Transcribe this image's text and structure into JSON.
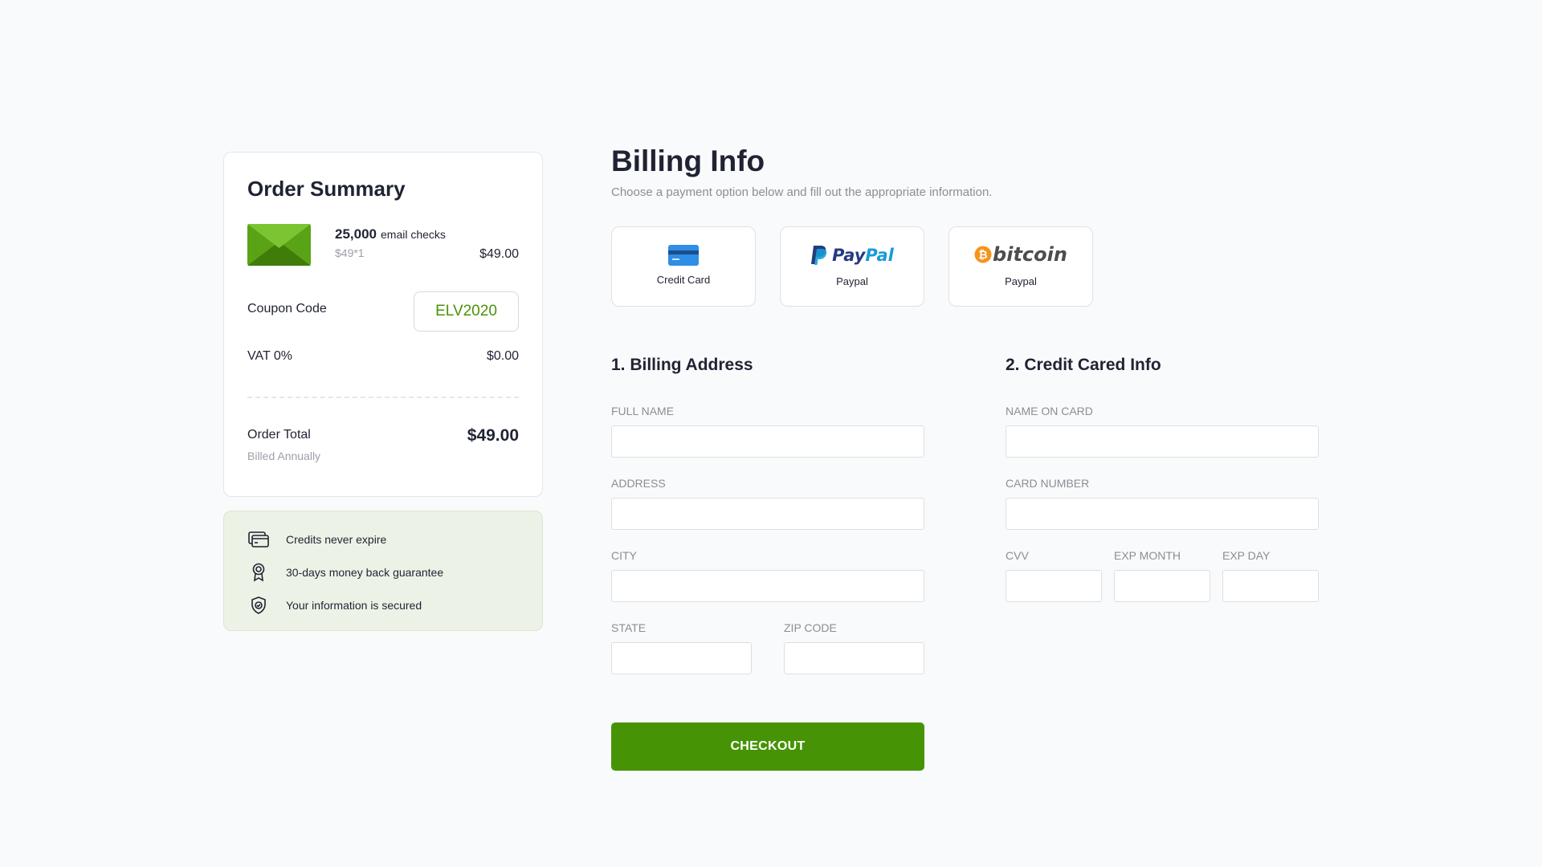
{
  "order_summary": {
    "title": "Order Summary",
    "product": {
      "icon": "envelope-icon",
      "quantity": "25,000",
      "unit_label": "email checks",
      "unit_price": "$49*1",
      "price": "$49.00"
    },
    "coupon": {
      "label": "Coupon Code",
      "value": "ELV2020"
    },
    "vat": {
      "label": "VAT 0%",
      "value": "$0.00"
    },
    "total": {
      "label": "Order Total",
      "sub_label": "Billed Annually",
      "value": "$49.00"
    }
  },
  "benefits": [
    {
      "icon": "credit-card-icon",
      "text": "Credits never expire"
    },
    {
      "icon": "award-ribbon-icon",
      "text": "30-days money back guarantee"
    },
    {
      "icon": "shield-check-icon",
      "text": "Your information is secured"
    }
  ],
  "billing": {
    "title": "Billing Info",
    "subtitle": "Choose a payment option below and fill out the appropriate information.",
    "payment_methods": [
      {
        "icon": "credit-card-icon",
        "label": "Credit Card"
      },
      {
        "icon": "paypal-logo",
        "logo_text_a": "Pay",
        "logo_text_b": "Pal",
        "label": "Paypal"
      },
      {
        "icon": "bitcoin-logo",
        "logo_text": "bitcoin",
        "label": "Paypal"
      }
    ]
  },
  "billing_address": {
    "title": "1. Billing Address",
    "fields": {
      "full_name": {
        "label": "FULL NAME",
        "value": ""
      },
      "address": {
        "label": "ADDRESS",
        "value": ""
      },
      "city": {
        "label": "CITY",
        "value": ""
      },
      "state": {
        "label": "STATE",
        "value": ""
      },
      "zip": {
        "label": "ZIP CODE",
        "value": ""
      }
    }
  },
  "card_info": {
    "title": "2. Credit  Cared Info",
    "fields": {
      "name_on_card": {
        "label": "NAME ON CARD",
        "value": ""
      },
      "card_number": {
        "label": "CARD NUMBER",
        "value": ""
      },
      "cvv": {
        "label": "CVV",
        "value": ""
      },
      "exp_month": {
        "label": "EXP MONTH",
        "value": ""
      },
      "exp_day": {
        "label": "EXP DAY",
        "value": ""
      }
    }
  },
  "checkout": {
    "label": "CHECKOUT"
  },
  "colors": {
    "accent": "#469406",
    "coupon_text": "#4a9208",
    "benefits_bg": "#ecf3e6",
    "paypal_dark": "#253b80",
    "paypal_light": "#179bd7",
    "bitcoin_orange": "#f7931a"
  }
}
